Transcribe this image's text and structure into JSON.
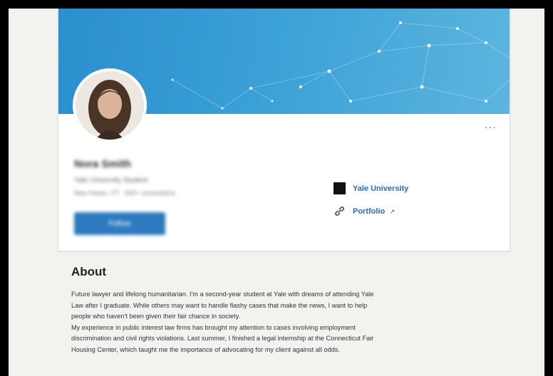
{
  "profile": {
    "name": "Nora Smith",
    "headline": "Yale University Student",
    "meta": "New Haven, CT · 500+ connections",
    "primary_action": "Follow",
    "more_label": "···",
    "education": {
      "label": "Yale University",
      "icon": "university-logo"
    },
    "portfolio": {
      "label": "Portfolio",
      "icon": "link-icon",
      "external_icon": "external-link-icon"
    }
  },
  "about": {
    "title": "About",
    "lines": [
      "Future lawyer and lifelong humanitarian. I'm a second-year student at Yale with dreams of attending Yale",
      "Law after I graduate. While others may want to handle flashy cases that make the news, I want to help",
      "people who haven't been given their fair chance in society.",
      "My experience in public interest law firms has brought my attention to cases involving employment",
      "discrimination and civil rights violations. Last summer, I finished a legal internship at the Connecticut Fair",
      "Housing Center, which taught me the importance of advocating for my client against all odds."
    ]
  },
  "colors": {
    "banner": "#3aa0d6",
    "link": "#2b6cb0",
    "button": "#2e7abf"
  }
}
